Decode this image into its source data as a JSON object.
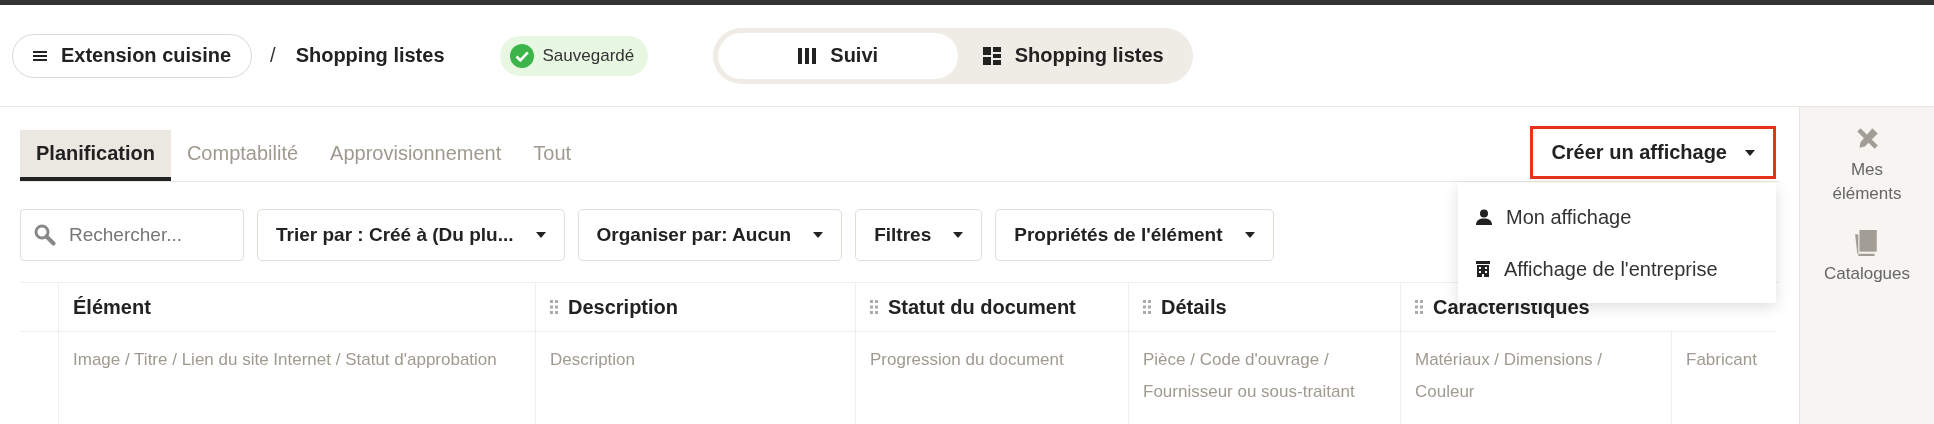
{
  "header": {
    "project_button": {
      "label": "Extension cuisine"
    },
    "separator": "/",
    "page_title": "Shopping listes",
    "save_status": "Sauvegardé",
    "view_switch": [
      {
        "label": "Suivi",
        "selected": true
      },
      {
        "label": "Shopping listes",
        "selected": false
      }
    ]
  },
  "tabs": [
    {
      "label": "Planification",
      "selected": true
    },
    {
      "label": "Comptabilité",
      "selected": false
    },
    {
      "label": "Approvisionnement",
      "selected": false
    },
    {
      "label": "Tout",
      "selected": false
    }
  ],
  "create_view": {
    "label": "Créer un affichage",
    "highlighted": true
  },
  "menu": [
    {
      "label": "Mon affichage"
    },
    {
      "label": "Affichage de l'entreprise"
    }
  ],
  "toolbar": {
    "search": {
      "placeholder": "Rechercher..."
    },
    "dropdowns": [
      "Trier par : Créé à (Du plu...",
      "Organiser par: Aucun",
      "Filtres",
      "Propriétés de l'élément"
    ]
  },
  "table": {
    "columns": [
      {
        "label": "Élément",
        "draggable": false,
        "wide": false
      },
      {
        "label": "Description",
        "draggable": true,
        "wide": false
      },
      {
        "label": "Statut du document",
        "draggable": true,
        "wide": false
      },
      {
        "label": "Détails",
        "draggable": true,
        "wide": false
      },
      {
        "label": "Caractéristiques",
        "draggable": true,
        "wide": true
      }
    ],
    "row": [
      "Image / Titre / Lien du site Internet / Statut d'approbation",
      "Description",
      "Progression du document",
      "Pièce / Code d'ouvrage / Fournisseur ou sous-traitant",
      "Matériaux / Dimensions / Couleur",
      "Fabricant"
    ]
  },
  "sidebar": [
    {
      "label": "Mes éléments"
    },
    {
      "label": "Catalogues"
    }
  ]
}
